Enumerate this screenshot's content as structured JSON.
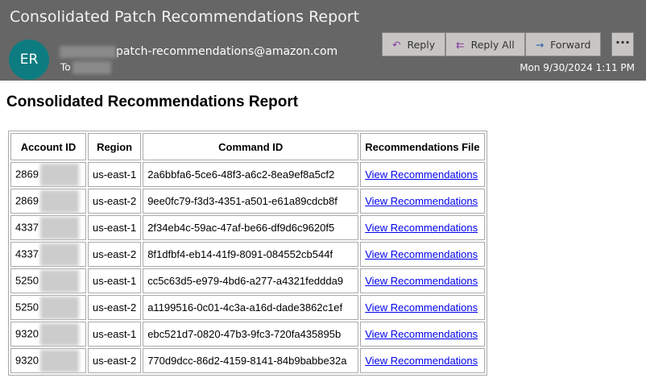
{
  "email": {
    "subject": "Consolidated Patch Recommendations Report",
    "avatar_initials": "ER",
    "from": "patch-recommendations@amazon.com",
    "to_label": "To",
    "date": "Mon 9/30/2024 1:11 PM",
    "actions": {
      "reply": "Reply",
      "reply_all": "Reply All",
      "forward": "Forward",
      "more": "···"
    }
  },
  "body": {
    "title": "Consolidated Recommendations Report",
    "columns": [
      "Account ID",
      "Region",
      "Command ID",
      "Recommendations File"
    ],
    "rows": [
      {
        "account": "2869",
        "region": "us-east-1",
        "command": "2a6bbfa6-5ce6-48f3-a6c2-8ea9ef8a5cf2",
        "link": "View Recommendations"
      },
      {
        "account": "2869",
        "region": "us-east-2",
        "command": "9ee0fc79-f3d3-4351-a501-e61a89cdcb8f",
        "link": "View Recommendations"
      },
      {
        "account": "4337",
        "region": "us-east-1",
        "command": "2f34eb4c-59ac-47af-be66-df9d6c9620f5",
        "link": "View Recommendations"
      },
      {
        "account": "4337",
        "region": "us-east-2",
        "command": "8f1dfbf4-eb14-41f9-8091-084552cb544f",
        "link": "View Recommendations"
      },
      {
        "account": "5250",
        "region": "us-east-1",
        "command": "cc5c63d5-e979-4bd6-a277-a4321feddda9",
        "link": "View Recommendations"
      },
      {
        "account": "5250",
        "region": "us-east-2",
        "command": "a1199516-0c01-4c3a-a16d-dade3862c1ef",
        "link": "View Recommendations"
      },
      {
        "account": "9320",
        "region": "us-east-1",
        "command": "ebc521d7-0820-47b3-9fc3-720fa435895b",
        "link": "View Recommendations"
      },
      {
        "account": "9320",
        "region": "us-east-2",
        "command": "770d9dcc-86d2-4159-8141-84b9babbe32a",
        "link": "View Recommendations"
      }
    ]
  }
}
